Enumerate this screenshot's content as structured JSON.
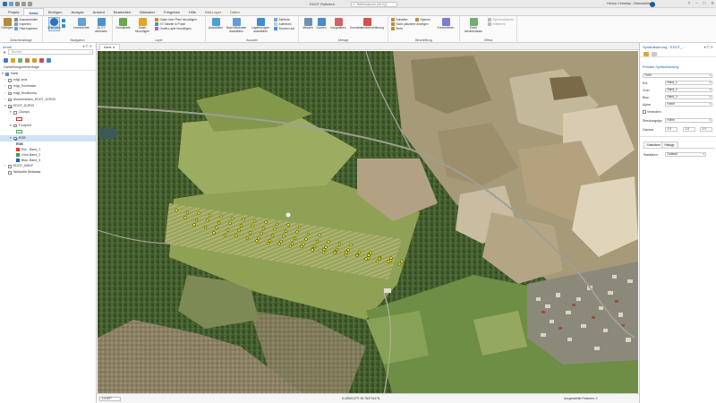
{
  "titlebar": {
    "title": "EDOT Rotleiten",
    "search_placeholder": "Befehlssuche (Alt+Q)",
    "user": "Heimo Christian - Bahnsteiler",
    "avatar_initials": "HC",
    "window_buttons": [
      "?",
      "–",
      "□",
      "✕"
    ]
  },
  "tabs": [
    "Projekt",
    "Karte",
    "Einfügen",
    "Analyse",
    "Ansicht",
    "Bearbeiten",
    "Bildraster",
    "Freigeben",
    "Hilfe",
    "Bild-Layer",
    "Daten"
  ],
  "active_tab": "Karte",
  "ribbon": {
    "clipboard": {
      "paste": "Einfügen",
      "cut": "Ausschneiden",
      "copy": "Kopieren",
      "copy_path": "Pfad kopieren",
      "label": "Zwischenablage"
    },
    "navigate": {
      "explore": "Erkunden",
      "bookmarks": "Lesezeichen",
      "goto": "Zu XY wechseln",
      "label": "Navigation"
    },
    "layer": {
      "basemap": "Grundkarte",
      "add_data": "Daten hinzufügen",
      "add_xy": "Daten über Pixel hinzufügen",
      "xy_table": "XY-Tabelle in Punkt",
      "graphics": "Grafik-Layer hinzufügen",
      "label": "Layer"
    },
    "selection": {
      "select": "Auswählen",
      "by_attr": "Nach Attributen auswählen",
      "by_location": "Lagebezogen auswählen",
      "attributes": "Attribute",
      "clear": "Aufheben",
      "zoom_to": "Zoomen auf",
      "label": "Auswahl"
    },
    "inquiry": {
      "measure": "Messen",
      "locate": "Suchen",
      "infographic": "Infografiken",
      "coord_conv": "Koordinatenkonvertierung",
      "label": "Abfrage"
    },
    "labeling": {
      "pause": "Anhalten",
      "lock": "Sperren",
      "unplaced": "Nicht platzierte anzeigen",
      "more": "Mehr",
      "convert": "Konvertieren",
      "label": "Beschriftung"
    },
    "offline": {
      "download": "Karte herunterladen",
      "sync": "Synchronisieren",
      "remove": "Entfernen",
      "label": "Offline"
    }
  },
  "contents": {
    "title": "Inhalt",
    "search_placeholder": "Suchen",
    "section": "Darstellungsreihenfolge",
    "map": "Karte",
    "layers": [
      {
        "name": "edgt_sma",
        "checked": false,
        "level": 1,
        "expanded": false
      },
      {
        "name": "edgt_Suchmaler",
        "checked": false,
        "level": 1,
        "expanded": false
      },
      {
        "name": "edgt_Monitoredu",
        "checked": false,
        "level": 1,
        "expanded": false
      },
      {
        "name": "Ausschneiden_EDOT_DOP20",
        "checked": false,
        "level": 1,
        "expanded": false
      },
      {
        "name": "EDOT_DOP20",
        "checked": true,
        "level": 1,
        "expanded": true
      },
      {
        "name": "Clumps",
        "checked": false,
        "level": 2,
        "expanded": true,
        "swatch": "#cc3333"
      },
      {
        "name": "Footprint",
        "checked": false,
        "level": 2,
        "expanded": true,
        "swatch": "#4caf50"
      },
      {
        "name": "RGB",
        "checked": true,
        "level": 2,
        "expanded": true,
        "selected": true
      }
    ],
    "rgb_legend": {
      "title": "RGB",
      "bands": [
        {
          "label": "Rot:",
          "value": "Band_1",
          "color": "#e53935"
        },
        {
          "label": "Grün:",
          "value": "Band_2",
          "color": "#43a047"
        },
        {
          "label": "Blau:",
          "value": "Band_3",
          "color": "#1e5cc8"
        }
      ]
    },
    "extra_layers": [
      {
        "name": "EDOT_DIBKF",
        "checked": false
      },
      {
        "name": "Weltweite Bildkatas",
        "checked": false
      }
    ]
  },
  "map_view": {
    "tab_label": "Karte",
    "scale": "1:6.697",
    "coordinates": "8.4952012°E 50.7837414°N",
    "selected_features": "Ausgewählte Features: 0"
  },
  "symbology": {
    "title": "Symbolisierung - EDOT_...",
    "primary_title": "Primäre Symbolisierung",
    "renderer": "RGB",
    "fields": [
      {
        "label": "Rot",
        "value": "Band_1"
      },
      {
        "label": "Grün",
        "value": "Band_2"
      },
      {
        "label": "Blau",
        "value": "Band_3"
      },
      {
        "label": "Alpha",
        "value": "Keine"
      }
    ],
    "transparency_checkbox": "Verändern",
    "stretch_label": "Streckungstyp",
    "stretch_value": "Keine",
    "gamma_label": "Gamma",
    "gamma_values": [
      "1.0",
      "1.0",
      "1.0"
    ],
    "tabs": [
      "Statistiken",
      "Histogr."
    ],
    "statistics_label": "Statistiken",
    "statistics_value": "Dataset"
  },
  "colors": {
    "accent": "#1b62a8",
    "marker_fill": "#e9e400",
    "marker_outline": "#111111"
  },
  "icons": [
    "search-icon",
    "filter-icon",
    "pin-icon",
    "close-icon",
    "auto-hide-icon",
    "menu-icon",
    "paste-icon",
    "explore-icon",
    "bookmark-icon",
    "basemap-icon",
    "add-data-icon",
    "select-icon",
    "measure-icon",
    "locate-icon",
    "download-icon"
  ]
}
